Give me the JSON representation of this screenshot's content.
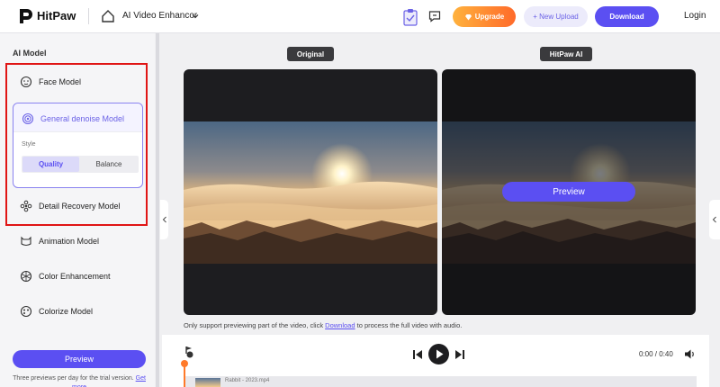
{
  "header": {
    "logo_text": "HitPaw",
    "app_title": "AI Video Enhancor",
    "upgrade_label": "Upgrade",
    "new_upload_label": "+ New Upload",
    "download_label": "Download",
    "login_label": "Login"
  },
  "sidebar": {
    "heading": "AI Model",
    "models": [
      {
        "label": "Face Model",
        "icon": "face-icon"
      },
      {
        "label": "General denoise Model",
        "icon": "denoise-icon",
        "selected": true
      },
      {
        "label": "Detail Recovery Model",
        "icon": "flower-icon"
      },
      {
        "label": "Animation Model",
        "icon": "animation-icon"
      },
      {
        "label": "Color Enhancement",
        "icon": "palette-icon"
      },
      {
        "label": "Colorize Model",
        "icon": "colorize-icon"
      }
    ],
    "style_label": "Style",
    "style_options": [
      "Quality",
      "Balance"
    ],
    "style_selected": "Quality",
    "preview_button": "Preview",
    "note_text": "Three previews per day for the trial version.",
    "note_link": "Get more"
  },
  "main": {
    "original_label": "Original",
    "ai_label": "HitPaw AI",
    "preview_button": "Preview",
    "notice_before": "Only support previewing part of the video, click ",
    "notice_link": "Download",
    "notice_after": " to process the full video with audio."
  },
  "player": {
    "time": "0:00 / 0:40",
    "file_name": "Rabbit - 2023.mp4"
  },
  "colors": {
    "accent": "#5b4ff2",
    "highlight_border": "#e01515",
    "playhead": "#ff7a2a"
  }
}
